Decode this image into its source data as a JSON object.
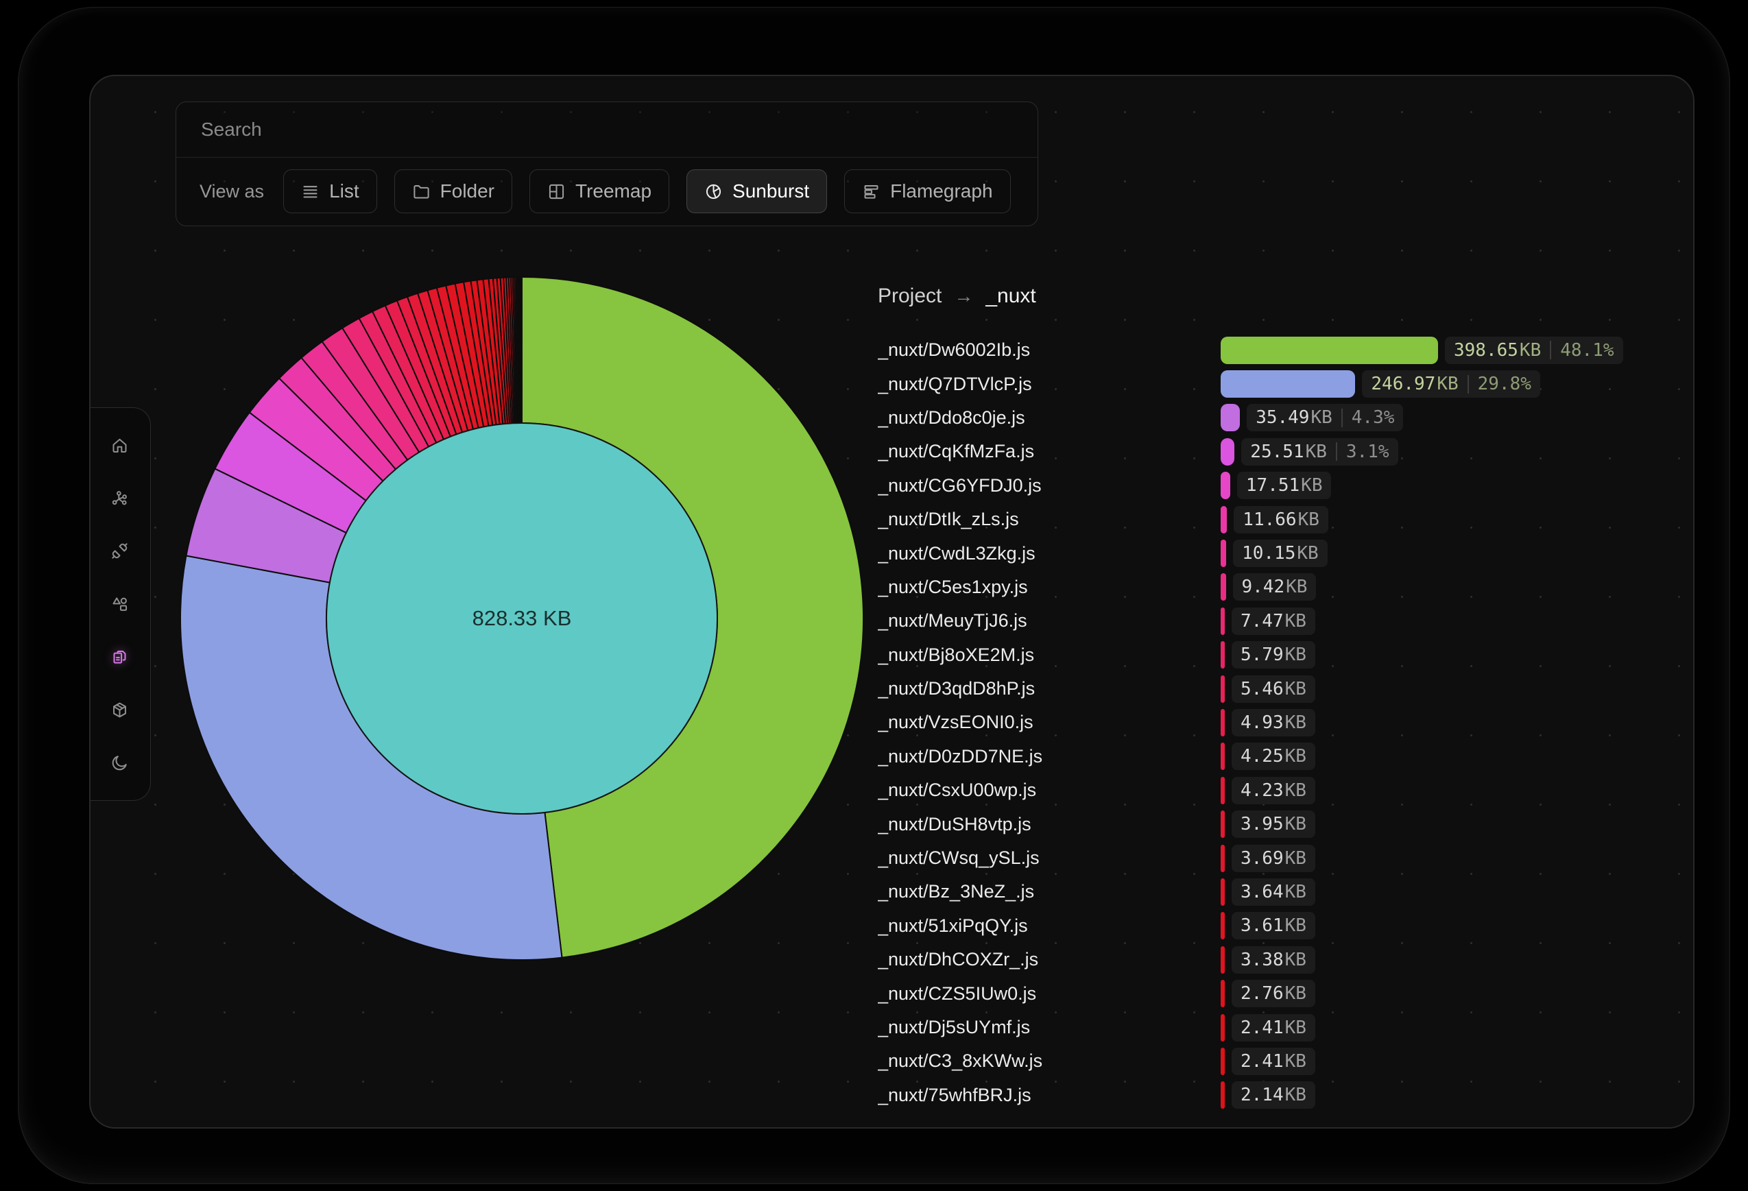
{
  "toolbar": {
    "search_placeholder": "Search",
    "view_as_label": "View as",
    "tabs": [
      {
        "label": "List",
        "icon": "list-icon",
        "active": false
      },
      {
        "label": "Folder",
        "icon": "folder-icon",
        "active": false
      },
      {
        "label": "Treemap",
        "icon": "treemap-icon",
        "active": false
      },
      {
        "label": "Sunburst",
        "icon": "sunburst-icon",
        "active": true
      },
      {
        "label": "Flamegraph",
        "icon": "flamegraph-icon",
        "active": false
      }
    ]
  },
  "sidebar": {
    "items": [
      {
        "icon": "home-icon",
        "active": false
      },
      {
        "icon": "workflow-icon",
        "active": false
      },
      {
        "icon": "plug-icon",
        "active": false
      },
      {
        "icon": "shapes-icon",
        "active": false
      },
      {
        "icon": "files-icon",
        "active": true
      },
      {
        "icon": "package-icon",
        "active": false
      },
      {
        "icon": "moon-icon",
        "active": false
      }
    ]
  },
  "breadcrumb": {
    "root": "Project",
    "arrow": "→",
    "current": "_nuxt"
  },
  "chart_data": {
    "type": "sunburst",
    "center_label": "828.33 KB",
    "total_kb": 828.33,
    "center_color": "#5fc9c5",
    "ring_stroke": "#0d0d0d",
    "files": [
      {
        "name": "_nuxt/Dw6002Ib.js",
        "kb": 398.65,
        "size": "398.65",
        "unit": "KB",
        "pct": "48.1%",
        "color": "#87c43f",
        "emph": true
      },
      {
        "name": "_nuxt/Q7DTVlcP.js",
        "kb": 246.97,
        "size": "246.97",
        "unit": "KB",
        "pct": "29.8%",
        "color": "#8d9fe3",
        "emph": true
      },
      {
        "name": "_nuxt/Ddo8c0je.js",
        "kb": 35.49,
        "size": "35.49",
        "unit": "KB",
        "pct": "4.3%",
        "color": "#c06ee0",
        "emph": false
      },
      {
        "name": "_nuxt/CqKfMzFa.js",
        "kb": 25.51,
        "size": "25.51",
        "unit": "KB",
        "pct": "3.1%",
        "color": "#da55e0",
        "emph": false
      },
      {
        "name": "_nuxt/CG6YFDJ0.js",
        "kb": 17.51,
        "size": "17.51",
        "unit": "KB",
        "pct": null,
        "color": "#e746c6",
        "emph": false
      },
      {
        "name": "_nuxt/DtIk_zLs.js",
        "kb": 11.66,
        "size": "11.66",
        "unit": "KB",
        "pct": null,
        "color": "#ea38a8",
        "emph": false
      },
      {
        "name": "_nuxt/CwdL3Zkg.js",
        "kb": 10.15,
        "size": "10.15",
        "unit": "KB",
        "pct": null,
        "color": "#eb3194",
        "emph": false
      },
      {
        "name": "_nuxt/C5es1xpy.js",
        "kb": 9.42,
        "size": "9.42",
        "unit": "KB",
        "pct": null,
        "color": "#eb2c83",
        "emph": false
      },
      {
        "name": "_nuxt/MeuyTjJ6.js",
        "kb": 7.47,
        "size": "7.47",
        "unit": "KB",
        "pct": null,
        "color": "#ea2873",
        "emph": false
      },
      {
        "name": "_nuxt/Bj8oXE2M.js",
        "kb": 5.79,
        "size": "5.79",
        "unit": "KB",
        "pct": null,
        "color": "#e92465",
        "emph": false
      },
      {
        "name": "_nuxt/D3qdD8hP.js",
        "kb": 5.46,
        "size": "5.46",
        "unit": "KB",
        "pct": null,
        "color": "#e82158",
        "emph": false
      },
      {
        "name": "_nuxt/VzsEONI0.js",
        "kb": 4.93,
        "size": "4.93",
        "unit": "KB",
        "pct": null,
        "color": "#e71e4d",
        "emph": false
      },
      {
        "name": "_nuxt/D0zDD7NE.js",
        "kb": 4.25,
        "size": "4.25",
        "unit": "KB",
        "pct": null,
        "color": "#e61c42",
        "emph": false
      },
      {
        "name": "_nuxt/CsxU00wp.js",
        "kb": 4.23,
        "size": "4.23",
        "unit": "KB",
        "pct": null,
        "color": "#e51a39",
        "emph": false
      },
      {
        "name": "_nuxt/DuSH8vtp.js",
        "kb": 3.95,
        "size": "3.95",
        "unit": "KB",
        "pct": null,
        "color": "#e41931",
        "emph": false
      },
      {
        "name": "_nuxt/CWsq_ySL.js",
        "kb": 3.69,
        "size": "3.69",
        "unit": "KB",
        "pct": null,
        "color": "#e3172b",
        "emph": false
      },
      {
        "name": "_nuxt/Bz_3NeZ_.js",
        "kb": 3.64,
        "size": "3.64",
        "unit": "KB",
        "pct": null,
        "color": "#e21626",
        "emph": false
      },
      {
        "name": "_nuxt/51xiPqQY.js",
        "kb": 3.61,
        "size": "3.61",
        "unit": "KB",
        "pct": null,
        "color": "#e11522",
        "emph": false
      },
      {
        "name": "_nuxt/DhCOXZr_.js",
        "kb": 3.38,
        "size": "3.38",
        "unit": "KB",
        "pct": null,
        "color": "#e0141f",
        "emph": false
      },
      {
        "name": "_nuxt/CZS5IUw0.js",
        "kb": 2.76,
        "size": "2.76",
        "unit": "KB",
        "pct": null,
        "color": "#e0131d",
        "emph": false
      },
      {
        "name": "_nuxt/Dj5sUYmf.js",
        "kb": 2.41,
        "size": "2.41",
        "unit": "KB",
        "pct": null,
        "color": "#df131b",
        "emph": false
      },
      {
        "name": "_nuxt/C3_8xKWw.js",
        "kb": 2.41,
        "size": "2.41",
        "unit": "KB",
        "pct": null,
        "color": "#df121a",
        "emph": false
      },
      {
        "name": "_nuxt/75whfBRJ.js",
        "kb": 2.14,
        "size": "2.14",
        "unit": "KB",
        "pct": null,
        "color": "#de1219",
        "emph": false
      }
    ],
    "unlisted_tail_kb": [
      1.7,
      1.5,
      1.35,
      1.2,
      1.05,
      0.95,
      0.85,
      0.75,
      0.65,
      0.6,
      0.5,
      0.45,
      0.4,
      0.35,
      0.3,
      0.25
    ],
    "tail_color": "#dc1119"
  }
}
